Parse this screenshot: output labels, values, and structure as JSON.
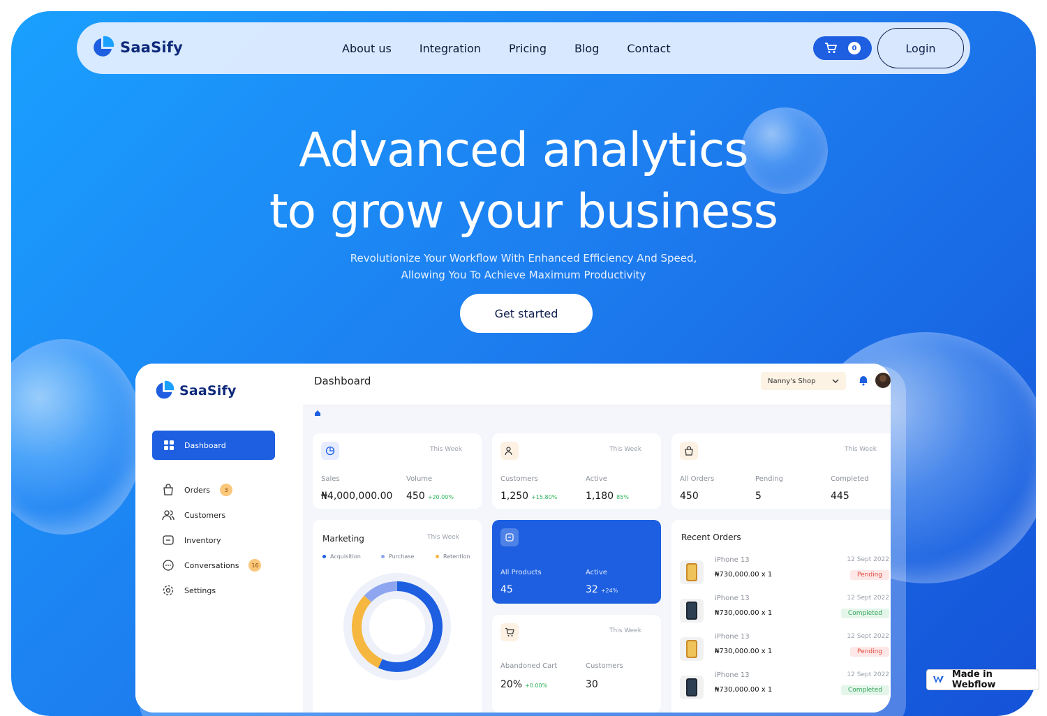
{
  "brand": {
    "name": "SaaSify",
    "accent": "#1d5fe0"
  },
  "nav": {
    "links": [
      "About us",
      "Integration",
      "Pricing",
      "Blog",
      "Contact"
    ],
    "cart_count": "0",
    "login_label": "Login"
  },
  "hero": {
    "headline_line1": "Advanced analytics",
    "headline_line2": "to grow your business",
    "sub_line1": "Revolutionize Your Workflow With Enhanced Efficiency And Speed,",
    "sub_line2": "Allowing You To Achieve Maximum Productivity",
    "cta_label": "Get started"
  },
  "dashboard": {
    "brand": "SaaSify",
    "title": "Dashboard",
    "shop": "Nanny's Shop",
    "sidebar": [
      {
        "label": "Dashboard",
        "icon": "grid-icon",
        "active": true
      },
      {
        "label": "Orders",
        "icon": "bag-icon",
        "badge": "3"
      },
      {
        "label": "Customers",
        "icon": "users-icon"
      },
      {
        "label": "Inventory",
        "icon": "folder-icon"
      },
      {
        "label": "Conversations",
        "icon": "chat-icon",
        "badge": "16"
      },
      {
        "label": "Settings",
        "icon": "gear-icon"
      }
    ],
    "period": "This Week",
    "sales_card": {
      "l1": "Sales",
      "v1": "₦4,000,000.00",
      "l2": "Volume",
      "v2": "450",
      "p2": "+20.00%"
    },
    "customers_card": {
      "l1": "Customers",
      "v1": "1,250",
      "p1": "+15.80%",
      "l2": "Active",
      "v2": "1,180",
      "p2": "85%"
    },
    "orders_card": {
      "l1": "All Orders",
      "v1": "450",
      "l2": "Pending",
      "v2": "5",
      "l3": "Completed",
      "v3": "445"
    },
    "marketing": {
      "title": "Marketing",
      "legend": [
        {
          "name": "Acquisition",
          "color": "#1d5fe0"
        },
        {
          "name": "Purchase",
          "color": "#8ea6f0"
        },
        {
          "name": "Retention",
          "color": "#f6b740"
        }
      ]
    },
    "products_card": {
      "l1": "All Products",
      "v1": "45",
      "l2": "Active",
      "v2": "32",
      "p2": "+24%"
    },
    "cart_card": {
      "l1": "Abandoned Cart",
      "v1": "20%",
      "p1": "+0.00%",
      "l2": "Customers",
      "v2": "30"
    },
    "recent_orders": {
      "title": "Recent Orders",
      "items": [
        {
          "name": "iPhone 13",
          "price": "₦730,000.00 x 1",
          "date": "12 Sept 2022",
          "status": "Pending"
        },
        {
          "name": "iPhone 13",
          "price": "₦730,000.00 x 1",
          "date": "12 Sept 2022",
          "status": "Completed"
        },
        {
          "name": "iPhone 13",
          "price": "₦730,000.00 x 1",
          "date": "12 Sept 2022",
          "status": "Pending"
        },
        {
          "name": "iPhone 13",
          "price": "₦730,000.00 x 1",
          "date": "12 Sept 2022",
          "status": "Completed"
        }
      ]
    }
  },
  "webflow_badge": "Made in Webflow"
}
